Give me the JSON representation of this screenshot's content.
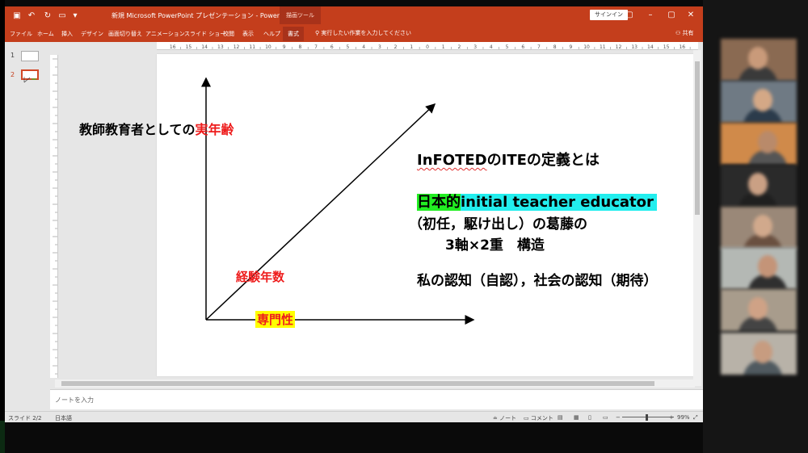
{
  "window": {
    "title": "新規 Microsoft PowerPoint プレゼンテーション - PowerPoint",
    "context_tab_group": "描画ツール",
    "signin_label": "サインイン",
    "qa_icons": [
      "save-icon",
      "undo-icon",
      "redo-icon",
      "start-slideshow-icon",
      "customize-icon"
    ]
  },
  "ribbon": {
    "tabs": [
      "ファイル",
      "ホーム",
      "挿入",
      "デザイン",
      "画面切り替え",
      "アニメーション",
      "スライド ショー",
      "校閲",
      "表示",
      "ヘルプ",
      "書式"
    ],
    "active_tab": "書式",
    "search_placeholder": "実行したい作業を入力してください",
    "share_label": "共有"
  },
  "thumbnails": {
    "items": [
      {
        "number": "1",
        "selected": false
      },
      {
        "number": "2",
        "selected": true
      }
    ]
  },
  "ruler": {
    "labels": [
      "16",
      "15",
      "14",
      "13",
      "12",
      "11",
      "10",
      "9",
      "8",
      "7",
      "6",
      "5",
      "4",
      "3",
      "2",
      "1",
      "0",
      "1",
      "2",
      "3",
      "4",
      "5",
      "6",
      "7",
      "8",
      "9",
      "10",
      "11",
      "12",
      "13",
      "14",
      "15",
      "16"
    ]
  },
  "slide": {
    "title_left_prefix": "教師教育者としての",
    "title_left_red": "実年齢",
    "label_experience": "経験年数",
    "label_expertise": "専門性",
    "heading_prefix": "InFOTED",
    "heading_suffix": "のITEの定義とは",
    "line1_green": "日本的",
    "line1_cyan": "initial teacher educator",
    "line2": "（初任，駆け出し）の葛藤の",
    "line3": "3軸×2重　構造",
    "line4": "私の認知（自認），社会の認知（期待）"
  },
  "notes": {
    "placeholder": "ノートを入力"
  },
  "status": {
    "slide_indicator": "スライド 2/2",
    "language": "日本語",
    "notes_label": "ノート",
    "comments_label": "コメント",
    "zoom": "99%"
  },
  "gallery": {
    "participants": [
      {
        "bg": "#8a6a52"
      },
      {
        "bg": "#6f7a84"
      },
      {
        "bg": "#d08a4a"
      },
      {
        "bg": "#2a2a2a"
      },
      {
        "bg": "#9a8878"
      },
      {
        "bg": "#b4b8b4"
      },
      {
        "bg": "#a89c8c"
      },
      {
        "bg": "#b8b2a8"
      }
    ]
  }
}
